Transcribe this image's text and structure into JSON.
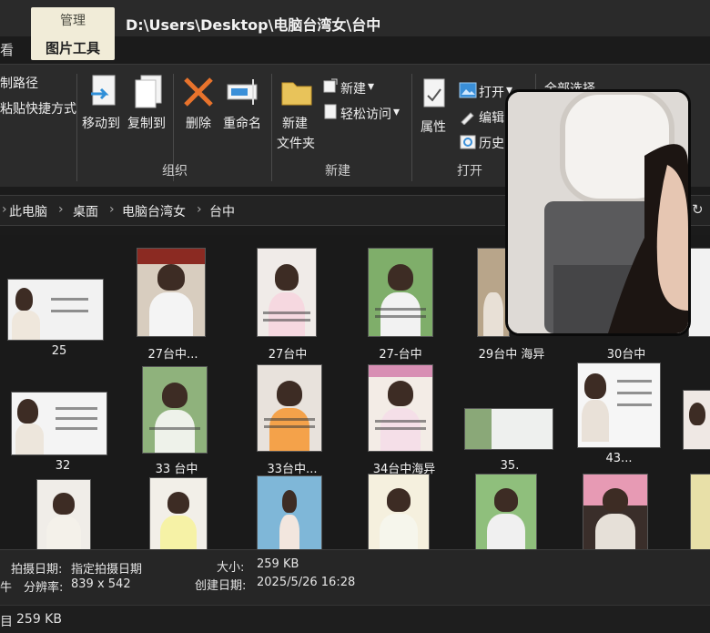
{
  "titlebar": {
    "manage_tab": "管理",
    "picture_tools_tab": "图片工具",
    "path": "D:\\Users\\Desktop\\电脑台湾女\\台中",
    "left_tab_fragment": "看"
  },
  "ribbon": {
    "clipboard": {
      "copy_path": "制路径",
      "paste_shortcut": "粘贴快捷方式"
    },
    "organize": {
      "move_to": "移动到",
      "copy_to": "复制到",
      "delete": "删除",
      "rename": "重命名",
      "group_label": "组织"
    },
    "new": {
      "new_folder_line1": "新建",
      "new_folder_line2": "文件夹",
      "new_item": "新建",
      "easy_access": "轻松访问",
      "group_label": "新建"
    },
    "open": {
      "properties": "属性",
      "open": "打开",
      "edit": "编辑",
      "history": "历史",
      "select_all_fragment": "全部选择",
      "group_label": "打开"
    }
  },
  "address": {
    "crumbs": [
      "此电脑",
      "桌面",
      "电脑台湾女",
      "台中"
    ],
    "separator": "›"
  },
  "files": {
    "row1": [
      "25",
      "27台中...",
      "27台中",
      "27-台中",
      "29台中 海异",
      "30台中"
    ],
    "row2": [
      "32",
      "33 台中",
      "33台中...",
      "34台中海异",
      "35.",
      "43..."
    ]
  },
  "details": {
    "date_taken_label": "拍摄日期:",
    "date_taken_value": "指定拍摄日期",
    "size_label": "大小:",
    "size_value": "259 KB",
    "resolution_label": "分辨率:",
    "resolution_value": "839 x 542",
    "created_label": "创建日期:",
    "created_value": "2025/5/26 16:28",
    "left_fragment": "牛"
  },
  "status": {
    "left_fragment": "目",
    "size": "259 KB"
  },
  "colors": {
    "window_bg": "#1b1b1b",
    "ribbon_bg": "#2b2b2b",
    "manage_tab": "#f1ecd8",
    "delete_icon": "#e8732c",
    "folder_icon": "#e8c35a",
    "picture_icon": "#3a8fd8"
  },
  "icons": [
    "move-to-icon",
    "copy-to-icon",
    "delete-icon",
    "rename-icon",
    "new-folder-icon",
    "new-item-icon",
    "easy-access-icon",
    "properties-icon",
    "open-icon",
    "edit-icon",
    "history-icon",
    "refresh-icon"
  ]
}
